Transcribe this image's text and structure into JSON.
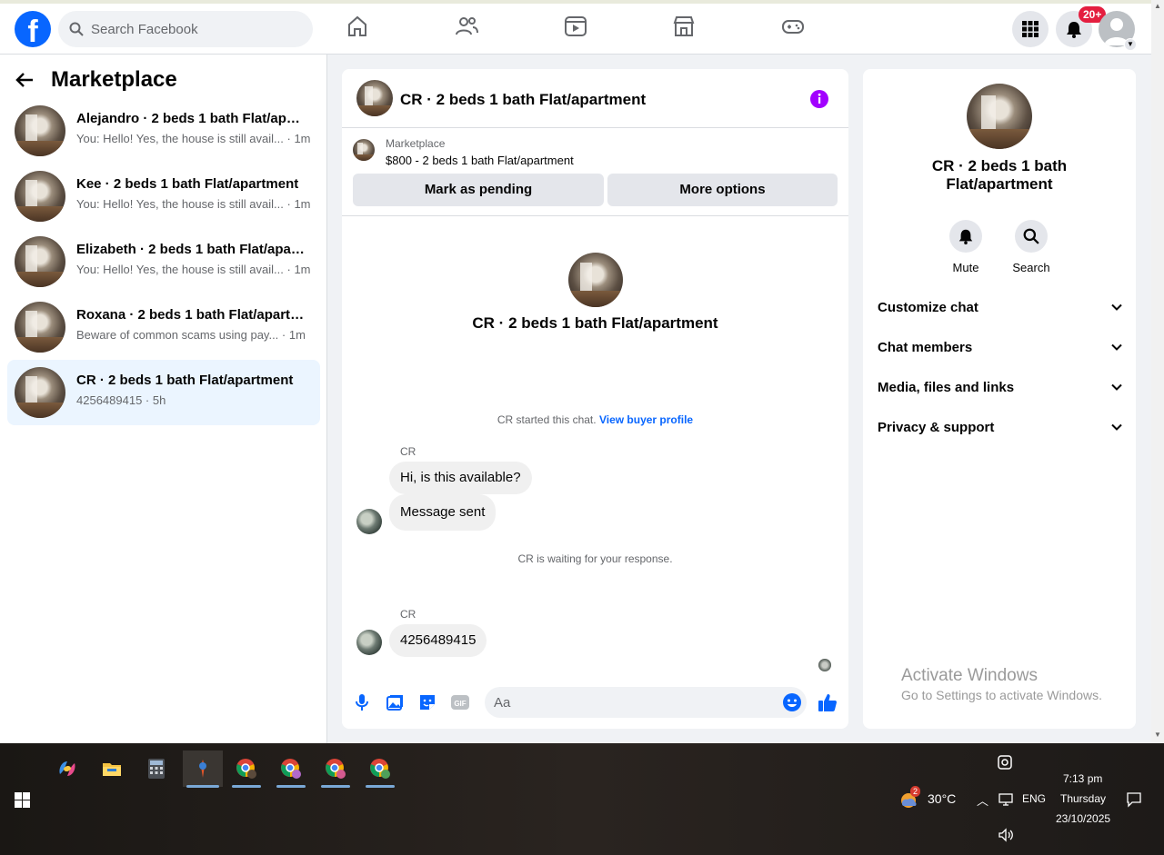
{
  "topbar": {
    "search_placeholder": "Search Facebook",
    "notification_badge": "20+"
  },
  "sidebar": {
    "title": "Marketplace",
    "conversations": [
      {
        "name": "Alejandro · 2 beds 1 bath Flat/apartment",
        "preview": "You: Hello! Yes, the house is still avail...",
        "time": "1m"
      },
      {
        "name": "Kee · 2 beds 1 bath Flat/apartment",
        "preview": "You: Hello! Yes, the house is still avail...",
        "time": "1m"
      },
      {
        "name": "Elizabeth · 2 beds 1 bath Flat/apartment",
        "preview": "You: Hello! Yes, the house is still avail...",
        "time": "1m"
      },
      {
        "name": "Roxana · 2 beds 1 bath Flat/apartment",
        "preview": "Beware of common scams using pay...",
        "time": "1m"
      },
      {
        "name": "CR · 2 beds 1 bath Flat/apartment",
        "preview": "4256489415",
        "time": "5h"
      }
    ]
  },
  "chat": {
    "title": "CR · 2 beds 1 bath Flat/apartment",
    "listing_category": "Marketplace",
    "listing_price": "$800 - 2 beds 1 bath Flat/apartment",
    "mark_pending_label": "Mark as pending",
    "more_options_label": "More options",
    "intro_title": "CR · 2 beds 1 bath Flat/apartment",
    "started_text": "CR started this chat.",
    "view_buyer_profile": "View buyer profile",
    "sender1": "CR",
    "msg1": "Hi, is this available?",
    "msg2": "Message sent",
    "waiting_text": "CR is waiting for your response.",
    "sender2": "CR",
    "msg3": "4256489415",
    "input_placeholder": "Aa"
  },
  "details": {
    "title": "CR · 2 beds 1 bath Flat/apartment",
    "mute_label": "Mute",
    "search_label": "Search",
    "sections": [
      "Customize chat",
      "Chat members",
      "Media, files and links",
      "Privacy & support"
    ]
  },
  "watermark": {
    "line1": "Activate Windows",
    "line2": "Go to Settings to activate Windows."
  },
  "taskbar": {
    "weather_badge": "2",
    "temperature": "30°C",
    "language": "ENG",
    "time": "7:13 pm",
    "day": "Thursday",
    "date": "23/10/2025"
  },
  "colors": {
    "facebook_blue": "#0866ff",
    "info_purple": "#a200ff",
    "badge_red": "#e41e3f",
    "active_conversation": "#ebf5ff"
  }
}
